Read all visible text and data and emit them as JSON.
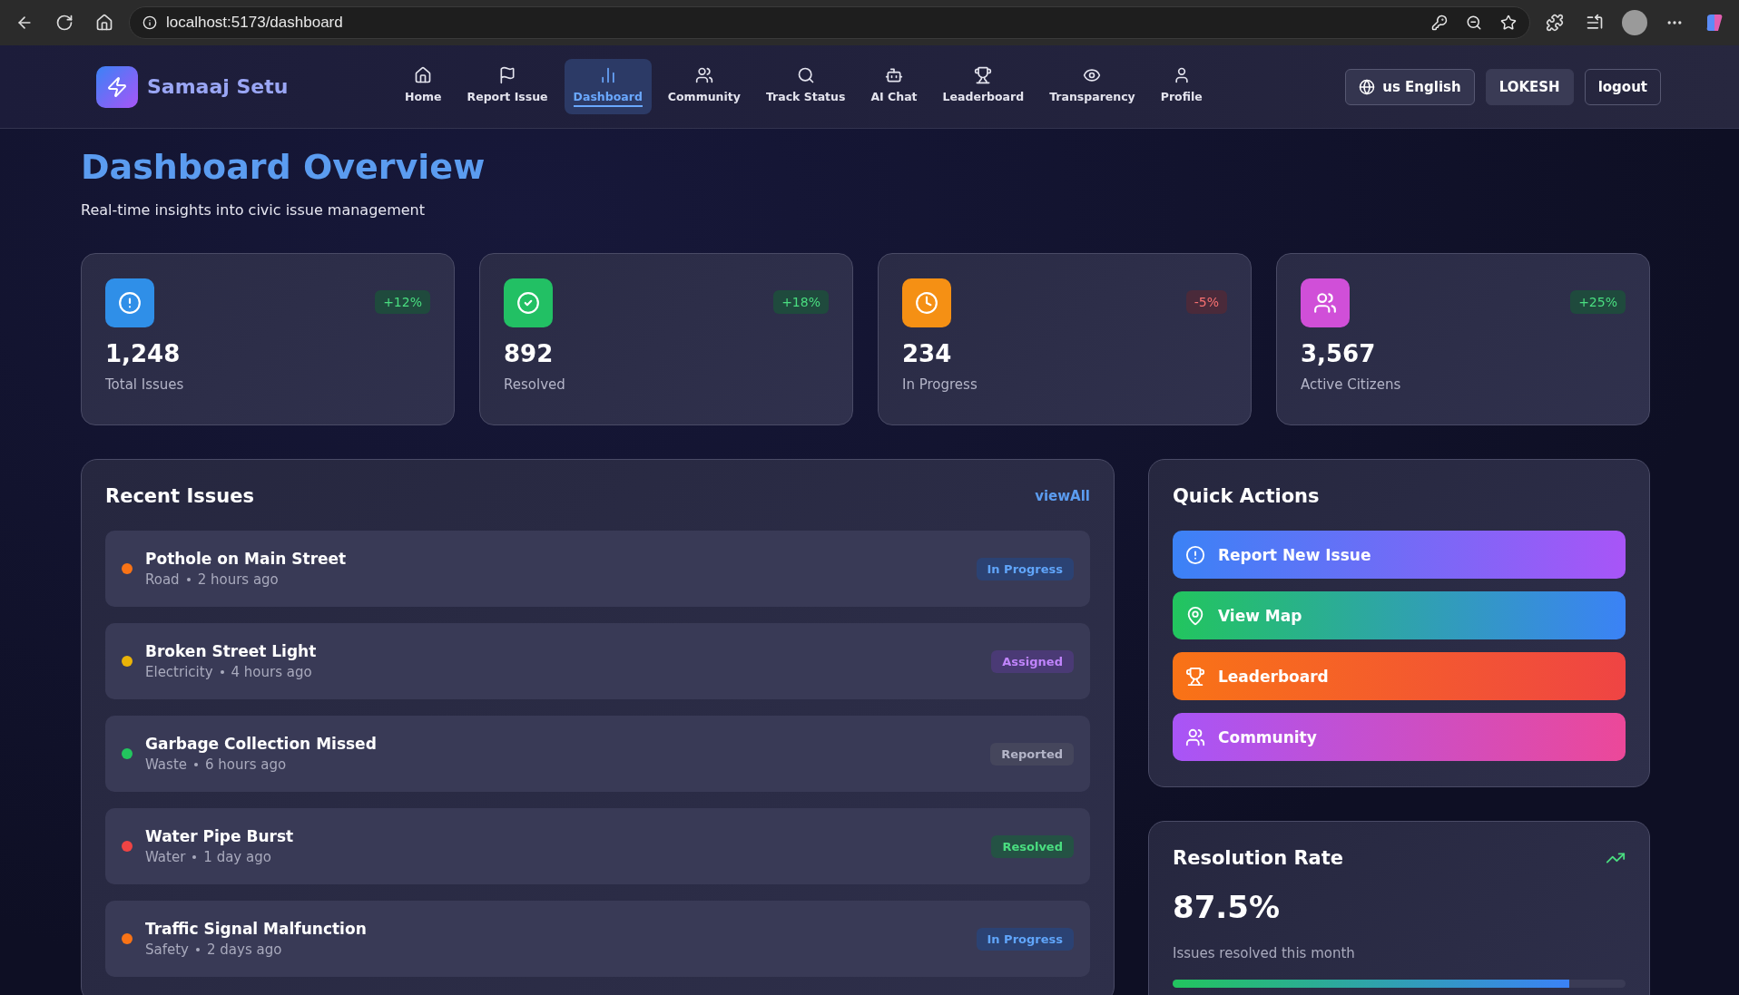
{
  "browser": {
    "address": "localhost:5173/dashboard"
  },
  "brand": {
    "name": "Samaaj Setu"
  },
  "nav": [
    {
      "label": "Home",
      "selected": false
    },
    {
      "label": "Report Issue",
      "selected": false
    },
    {
      "label": "Dashboard",
      "selected": true
    },
    {
      "label": "Community",
      "selected": false
    },
    {
      "label": "Track Status",
      "selected": false
    },
    {
      "label": "AI Chat",
      "selected": false
    },
    {
      "label": "Leaderboard",
      "selected": false
    },
    {
      "label": "Transparency",
      "selected": false
    },
    {
      "label": "Profile",
      "selected": false
    }
  ],
  "header_actions": {
    "language": "us English",
    "user": "LOKESH",
    "logout": "logout"
  },
  "page": {
    "title": "Dashboard Overview",
    "subtitle": "Real-time insights into civic issue management"
  },
  "stats": [
    {
      "value": "1,248",
      "label": "Total Issues",
      "change": "+12%",
      "kind": "up",
      "color": "#2f8fe8"
    },
    {
      "value": "892",
      "label": "Resolved",
      "change": "+18%",
      "kind": "up",
      "color": "#22c064"
    },
    {
      "value": "234",
      "label": "In Progress",
      "change": "-5%",
      "kind": "down",
      "color": "#f59014"
    },
    {
      "value": "3,567",
      "label": "Active Citizens",
      "change": "+25%",
      "kind": "up",
      "color": "#d04fd8"
    }
  ],
  "recent_issues": {
    "title": "Recent Issues",
    "view_all": "viewAll",
    "items": [
      {
        "title": "Pothole on Main Street",
        "category": "Road",
        "time": "2 hours ago",
        "color": "#f97316",
        "status": "In Progress",
        "kind": "progress"
      },
      {
        "title": "Broken Street Light",
        "category": "Electricity",
        "time": "4 hours ago",
        "color": "#eab308",
        "status": "Assigned",
        "kind": "assigned"
      },
      {
        "title": "Garbage Collection Missed",
        "category": "Waste",
        "time": "6 hours ago",
        "color": "#22c55e",
        "status": "Reported",
        "kind": "reported"
      },
      {
        "title": "Water Pipe Burst",
        "category": "Water",
        "time": "1 day ago",
        "color": "#ef4444",
        "status": "Resolved",
        "kind": "resolved"
      },
      {
        "title": "Traffic Signal Malfunction",
        "category": "Safety",
        "time": "2 days ago",
        "color": "#f97316",
        "status": "In Progress",
        "kind": "progress"
      }
    ]
  },
  "quick_actions": {
    "title": "Quick Actions",
    "items": [
      {
        "label": "Report New Issue"
      },
      {
        "label": "View Map"
      },
      {
        "label": "Leaderboard"
      },
      {
        "label": "Community"
      }
    ]
  },
  "resolution": {
    "title": "Resolution Rate",
    "value": "87.5%",
    "caption": "Issues resolved this month",
    "level": 0.875
  }
}
